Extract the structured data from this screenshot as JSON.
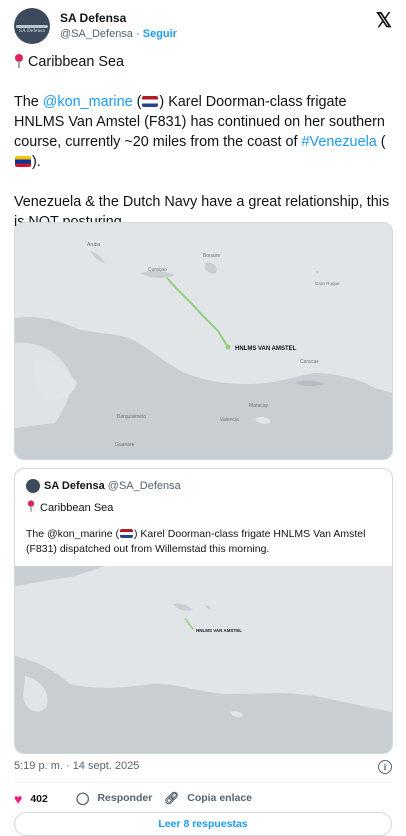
{
  "author": {
    "name": "SA Defensa",
    "handle": "@SA_Defensa",
    "separator": "·",
    "follow_label": "Seguir",
    "avatar_text": "SA Defensa"
  },
  "post": {
    "location": "Caribbean Sea",
    "para1_pre": "The ",
    "mention": "@kon_marine",
    "para1_mid": " (",
    "para1_post": ") Karel Doorman-class frigate HNLMS Van Amstel (F831) has continued on her southern course, currently ~20 miles from the coast of ",
    "hashtag": "#Venezuela",
    "para1_end1": " (",
    "para1_end2": ").",
    "para2": "Venezuela & the Dutch Navy have a great relationship, this is NOT posturing."
  },
  "map_main": {
    "ship_label": "HNLMS VAN AMSTEL",
    "places": {
      "aruba": "Aruba",
      "curacao": "Curaçao",
      "bonaire": "Bonaire",
      "gran_roque": "Gran Roque",
      "caracas": "Caracas",
      "barquisimeto": "Barquisimeto",
      "valencia": "Valencia",
      "maracay": "Maracay",
      "guanare": "Guanare"
    }
  },
  "quote": {
    "name": "SA Defensa",
    "handle": "@SA_Defensa",
    "location": "Caribbean Sea",
    "text_pre": "The @kon_marine (",
    "text_post": ") Karel Doorman-class frigate HNLMS Van Amstel (F831) dispatched out from Willemstad this morning.",
    "map_ship_label": "HNLMS VAN AMSTEL"
  },
  "meta": {
    "timestamp": "5:19 p. m. · 14 sept. 2025",
    "info_icon": "i"
  },
  "actions": {
    "likes": "402",
    "reply_label": "Responder",
    "copy_label": "Copia enlace",
    "replies_button": "Leer 8 respuestas"
  },
  "icons": {
    "heart": "heart-icon",
    "reply": "reply-icon",
    "link": "link-icon",
    "x": "x-logo-icon",
    "pin": "pin-icon",
    "info": "info-icon"
  },
  "colors": {
    "accent": "#1d9bf0",
    "like": "#f91880",
    "text": "#0f1419",
    "muted": "#536471",
    "land": "#c9ced3",
    "sea": "#e2e5e8",
    "track": "#8fd07a"
  }
}
